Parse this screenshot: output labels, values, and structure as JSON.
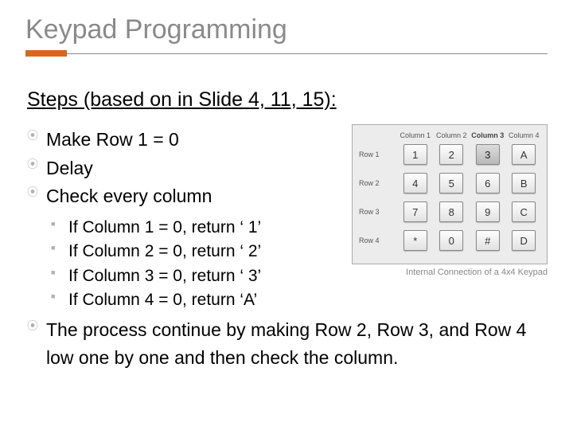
{
  "title": "Keypad Programming",
  "subhead": "Steps (based on in Slide 4, 11, 15):",
  "steps": {
    "a": "Make Row 1 = 0",
    "b": "Delay",
    "c": "Check every column",
    "sub1": "If Column 1 = 0, return ‘ 1’",
    "sub2": "If Column 2 = 0, return ‘ 2’",
    "sub3": "If Column 3 = 0, return ‘ 3’",
    "sub4": "If Column 4 = 0, return ‘A’",
    "d": "The process continue by making Row 2, Row 3, and Row 4 low one by one and then check the column."
  },
  "keypad": {
    "cols": {
      "c1": "Column 1",
      "c2": "Column 2",
      "c3": "Column 3",
      "c4": "Column 4"
    },
    "rows": {
      "r1": "Row 1",
      "r2": "Row 2",
      "r3": "Row 3",
      "r4": "Row 4"
    },
    "keys": {
      "r1c1": "1",
      "r1c2": "2",
      "r1c3": "3",
      "r1c4": "A",
      "r2c1": "4",
      "r2c2": "5",
      "r2c3": "6",
      "r2c4": "B",
      "r3c1": "7",
      "r3c2": "8",
      "r3c3": "9",
      "r3c4": "C",
      "r4c1": "*",
      "r4c2": "0",
      "r4c3": "#",
      "r4c4": "D"
    },
    "caption": "Internal Connection of a 4x4 Keypad"
  }
}
